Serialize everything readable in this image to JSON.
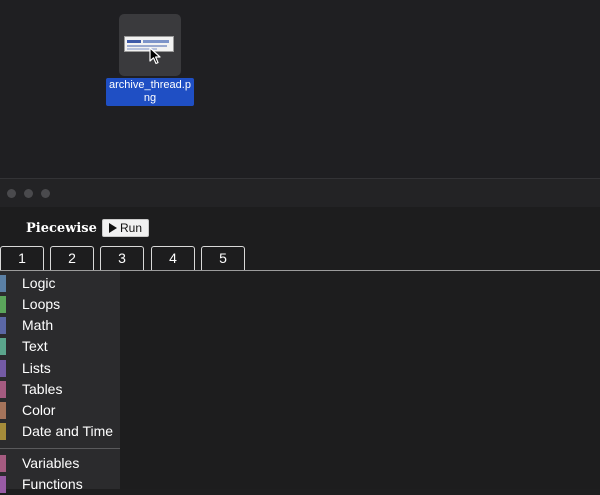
{
  "desktop": {
    "file": {
      "icon": "image-file-icon",
      "name": "archive_thread.png"
    },
    "cursor_icon": "arrow-cursor-icon"
  },
  "window": {
    "title": "Piecewise",
    "run_label": "Run",
    "run_icon": "play-icon",
    "tabs": [
      {
        "label": "1",
        "selected": true
      },
      {
        "label": "2"
      },
      {
        "label": "3"
      },
      {
        "label": "4"
      },
      {
        "label": "5"
      }
    ],
    "categories": [
      {
        "label": "Logic",
        "color": "#5b80a5"
      },
      {
        "label": "Loops",
        "color": "#5ba55b"
      },
      {
        "label": "Math",
        "color": "#5b67a5"
      },
      {
        "label": "Text",
        "color": "#5ba58c"
      },
      {
        "label": "Lists",
        "color": "#745ba5"
      },
      {
        "label": "Tables",
        "color": "#a55b80"
      },
      {
        "label": "Color",
        "color": "#a5745b"
      },
      {
        "label": "Date and Time",
        "color": "#a58c3a"
      },
      {
        "label": "Variables",
        "color": "#a55b80"
      },
      {
        "label": "Functions",
        "color": "#995ba5"
      }
    ]
  }
}
